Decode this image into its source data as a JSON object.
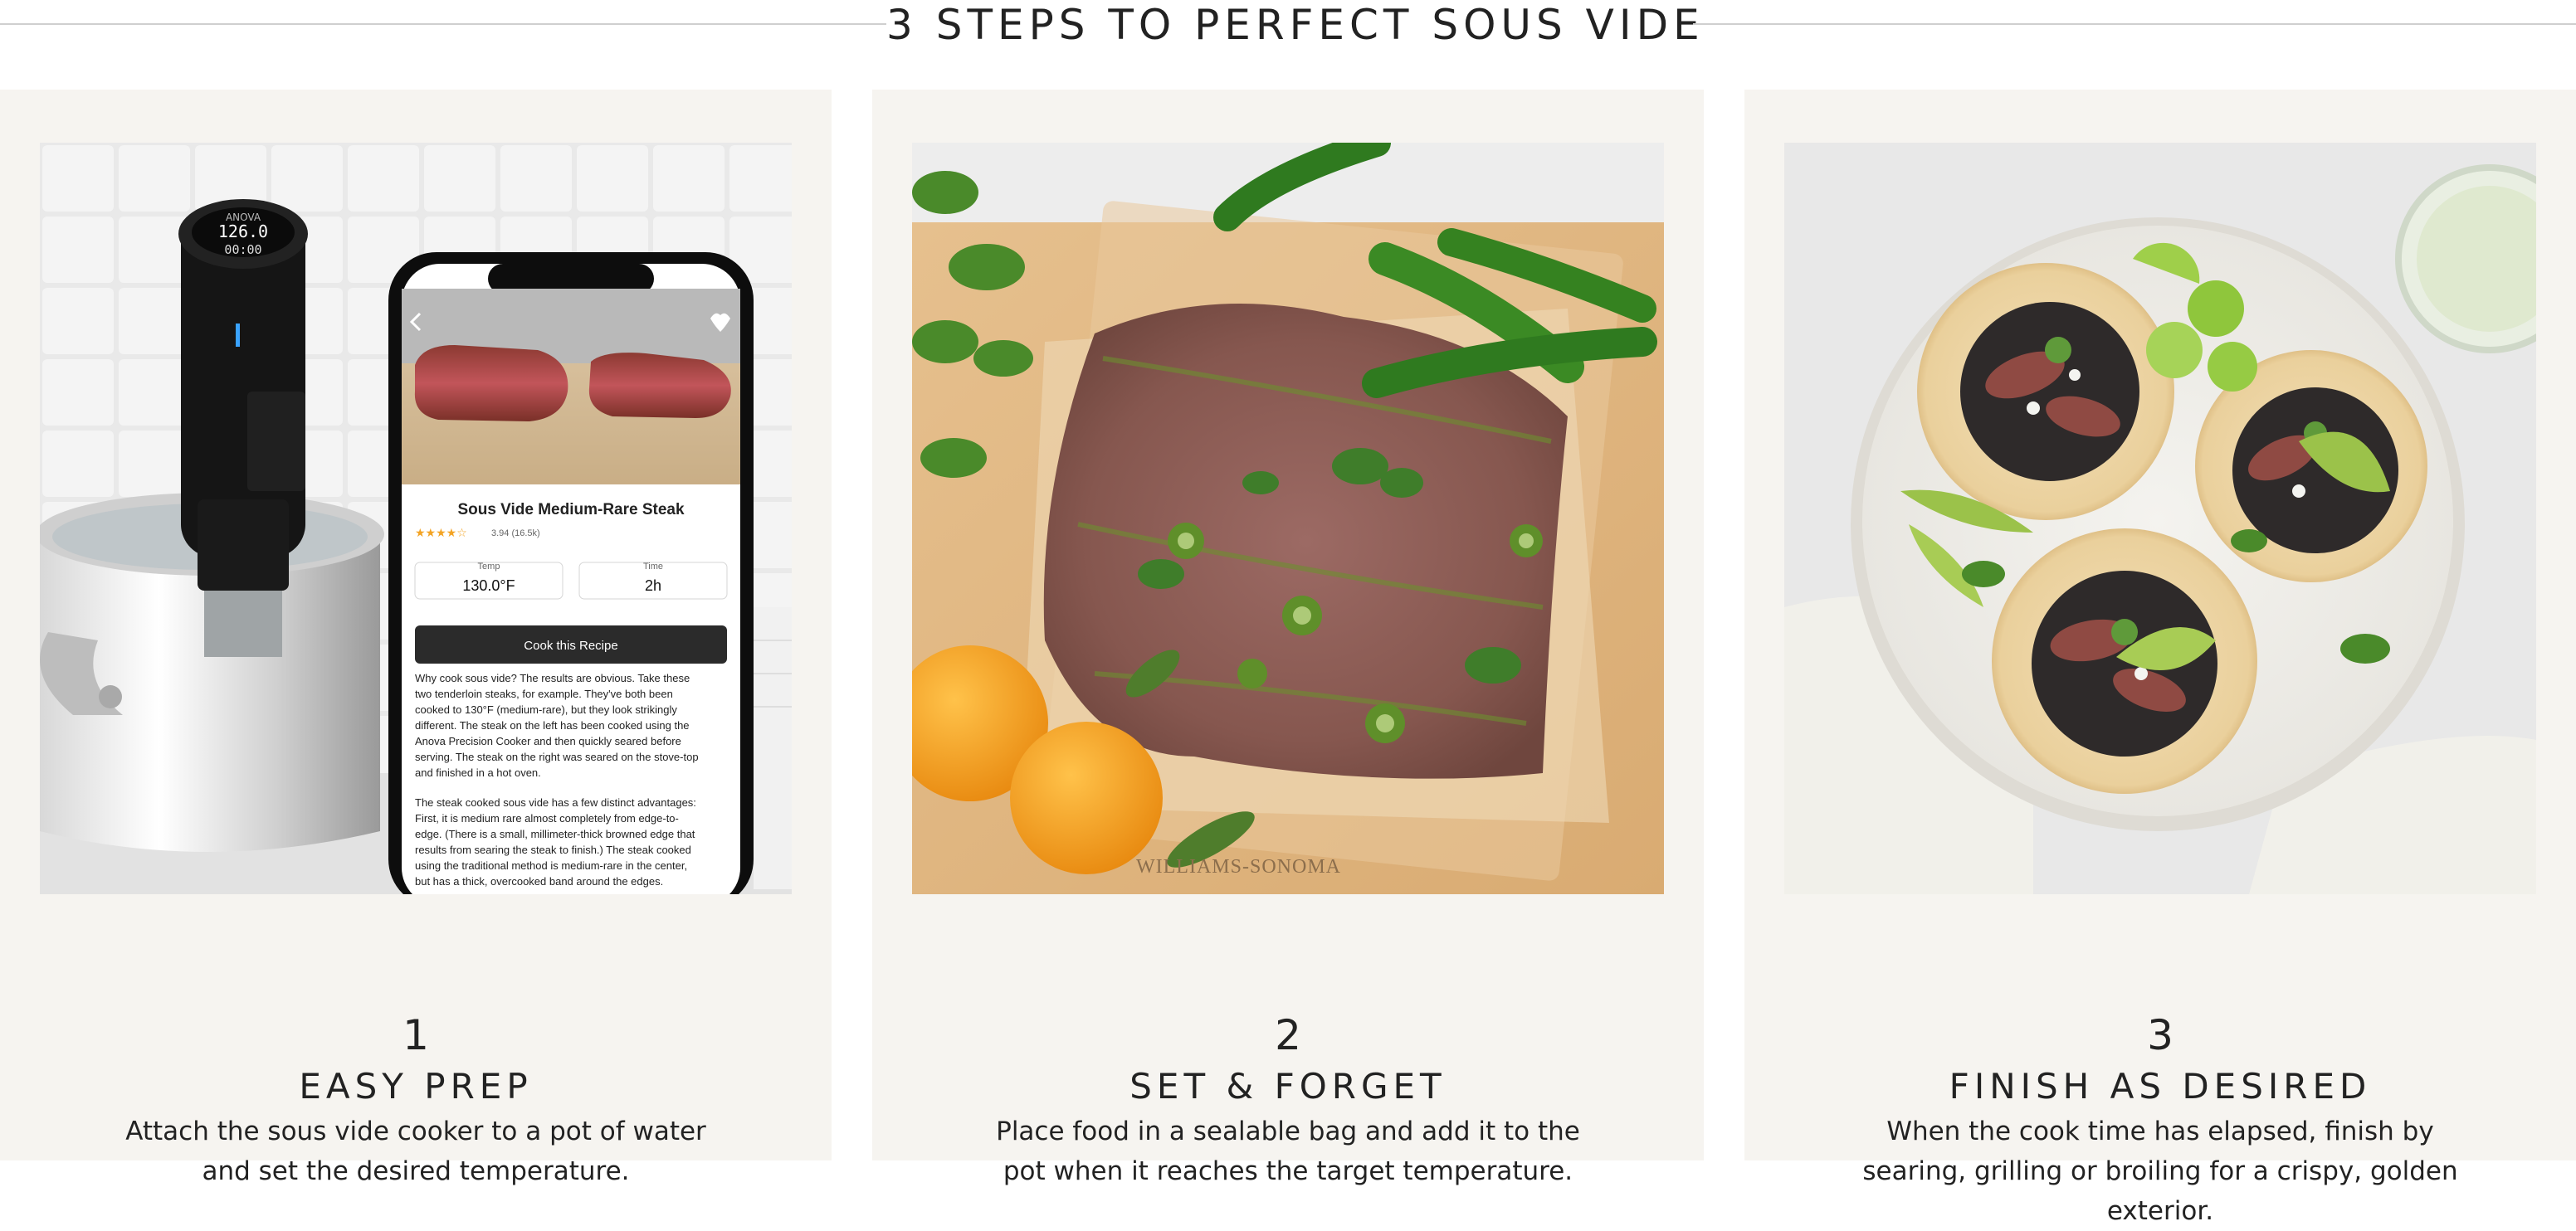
{
  "header": {
    "title": "3 STEPS TO PERFECT SOUS VIDE"
  },
  "steps": [
    {
      "number": "1",
      "title": "EASY PREP",
      "description": "Attach the sous vide cooker to a pot of water and set the desired temperature."
    },
    {
      "number": "2",
      "title": "SET & FORGET",
      "description": "Place food in a sealable bag and add it to the pot when it reaches the target temperature."
    },
    {
      "number": "3",
      "title": "FINISH AS DESIRED",
      "description": "When the cook time has elapsed, finish by searing, grilling or broiling for a crispy, golden exterior."
    }
  ],
  "device": {
    "brand": "ANOVA",
    "display_top": "126.0",
    "display_bottom": "00:00"
  },
  "phone": {
    "recipe_title": "Sous Vide Medium-Rare Steak",
    "rating_text": "3.94 (16.5k)",
    "rating": 3.94,
    "temp_label": "Temp",
    "temp_value": "130.0°F",
    "time_label": "Time",
    "time_value": "2h",
    "cta_label": "Cook this Recipe",
    "para1": [
      "Why cook sous vide? The results are obvious. Take these",
      "two tenderloin steaks, for example. They've both been",
      "cooked to 130°F (medium-rare), but they look strikingly",
      "different. The steak on the left has been cooked using the",
      "Anova Precision Cooker and then quickly seared before",
      "serving. The steak on the right was seared on the stove-top",
      "and finished in a hot oven."
    ],
    "para2": [
      "The steak cooked sous vide has a few distinct advantages:",
      "First, it is medium rare almost completely from edge-to-",
      "edge. (There is a small, millimeter-thick browned edge that",
      "results from searing the steak to finish.) The steak cooked",
      "using the traditional method is medium-rare in the center,",
      "but has a thick, overcooked band around the edges."
    ]
  },
  "bag_watermark": "WILLIAMS-SONOMA",
  "colors": {
    "card_bg": "#f6f4f0",
    "rule": "#cfcfcf",
    "star": "#f3a425",
    "cta": "#2b2b2b"
  }
}
